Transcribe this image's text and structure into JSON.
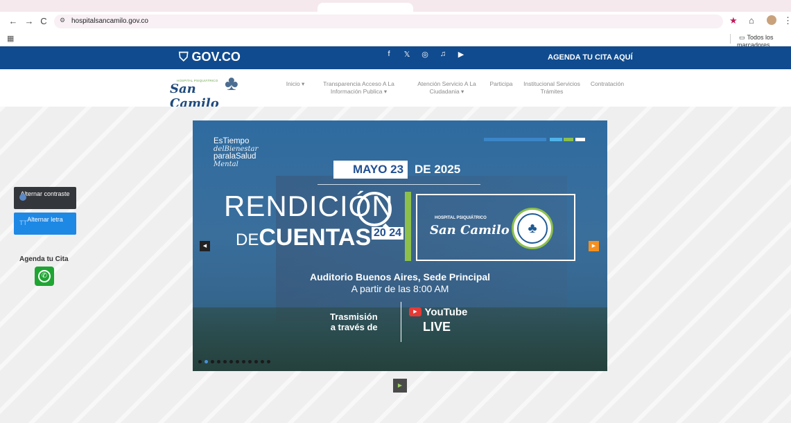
{
  "browser": {
    "url": "hospitalsancamilo.gov.co",
    "back_icon": "←",
    "forward_icon": "→",
    "reload_icon": "C",
    "site_info_icon": "⚙",
    "star_icon": "★",
    "extensions_icon": "⌂",
    "menu_icon": "⋮",
    "apps_icon": "▦",
    "folder_icon": "▭",
    "bookmarks_label": "Todos los marcadores"
  },
  "govbar": {
    "logo_text": "GOV.CO",
    "shield_icon": "⛉",
    "social": [
      "f",
      "𝕏",
      "◎",
      "♫",
      "▶"
    ],
    "agenda_link": "AGENDA TU CITA AQUÍ"
  },
  "header": {
    "brand_tag": "HOSPITAL PSIQUIÁTRICO",
    "brand_name": "San Camilo",
    "menu": [
      {
        "label": "Inicio ▾"
      },
      {
        "label": "Transparencia Acceso A La Información Publica ▾"
      },
      {
        "label": "Atención Servicio A La Ciudadania ▾"
      },
      {
        "label": "Participa"
      },
      {
        "label": "Institucional Servicios Trámites"
      },
      {
        "label": "Contratación"
      }
    ]
  },
  "accessibility": {
    "contrast_label": "Alternar contraste",
    "letter_label": "Alternar letra",
    "letter_icon": "TT"
  },
  "agenda": {
    "label": "Agenda tu Cita",
    "whatsapp_icon": "✆"
  },
  "carousel": {
    "tagline_1": "EsTiempo",
    "tagline_2": "delBienestar",
    "tagline_3": "paralaSalud",
    "tagline_4": "Mental",
    "date_highlight": "MAYO 23",
    "date_rest": "DE 2025",
    "title_1": "RENDICIÓN",
    "title_de": "DE",
    "title_2": "CUENTAS",
    "year": "20 24",
    "hospital_tag": "HOSPITAL PSIQUIÁTRICO",
    "hospital_name": "San Camilo",
    "location": "Auditorio Buenos Aires, Sede Principal",
    "time": "A partir de las 8:00 AM",
    "stream_1": "Trasmisión",
    "stream_2": "a través de",
    "youtube": "YouTube",
    "live": "LIVE",
    "prev_icon": "◀",
    "next_icon": "▶",
    "slide_count": 12,
    "active_slide": 2,
    "play_icon": "▶"
  },
  "colors": {
    "gov_blue": "#104b8f",
    "accent_orange": "#f5901e",
    "accent_green": "#8cc04b",
    "whatsapp_green": "#1fa533"
  }
}
